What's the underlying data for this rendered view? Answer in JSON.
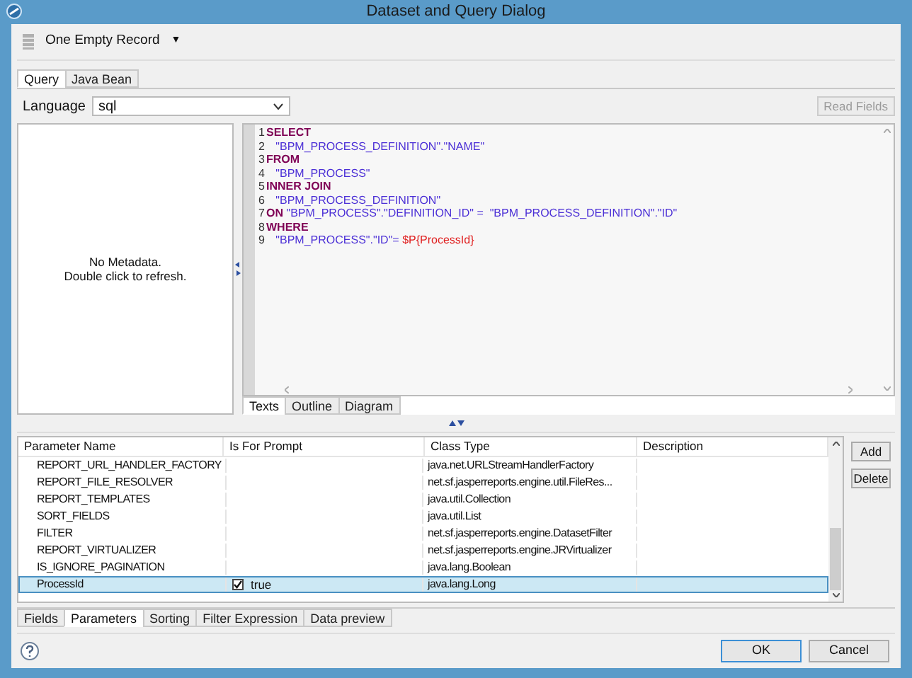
{
  "window": {
    "title": "Dataset and Query Dialog"
  },
  "toolbar": {
    "record_menu": {
      "label": "One Empty Record",
      "caret": "▼"
    }
  },
  "top_tabs": [
    {
      "label": "Query",
      "selected": true
    },
    {
      "label": "Java Bean",
      "selected": false
    }
  ],
  "language": {
    "label": "Language",
    "value": "sql",
    "read_fields": {
      "label": "Read Fields",
      "disabled": true
    }
  },
  "metadata": {
    "lines": [
      "No Metadata.",
      "Double click to refresh."
    ]
  },
  "editor": {
    "lines": [
      {
        "number": "1",
        "tokens": [
          {
            "kind": "keyword",
            "text": "SELECT"
          }
        ]
      },
      {
        "number": "2",
        "tokens": [
          {
            "kind": "string",
            "text": "   \"BPM_PROCESS_DEFINITION\".\"NAME\""
          }
        ]
      },
      {
        "number": "3",
        "tokens": [
          {
            "kind": "keyword",
            "text": "FROM"
          }
        ]
      },
      {
        "number": "4",
        "tokens": [
          {
            "kind": "string",
            "text": "   \"BPM_PROCESS\""
          }
        ]
      },
      {
        "number": "5",
        "tokens": [
          {
            "kind": "keyword",
            "text": "INNER JOIN"
          }
        ]
      },
      {
        "number": "6",
        "tokens": [
          {
            "kind": "string",
            "text": "   \"BPM_PROCESS_DEFINITION\""
          }
        ]
      },
      {
        "number": "7",
        "tokens": [
          {
            "kind": "keyword",
            "text": "ON"
          },
          {
            "kind": "string",
            "text": " \"BPM_PROCESS\".\"DEFINITION_ID\" =  \"BPM_PROCESS_DEFINITION\".\"ID\""
          }
        ]
      },
      {
        "number": "8",
        "tokens": [
          {
            "kind": "keyword",
            "text": "WHERE"
          }
        ]
      },
      {
        "number": "9",
        "tokens": [
          {
            "kind": "string",
            "text": "   \"BPM_PROCESS\".\"ID\"= "
          },
          {
            "kind": "param",
            "text": "$P{ProcessId}"
          }
        ]
      }
    ],
    "tabs": [
      {
        "label": "Texts",
        "selected": true
      },
      {
        "label": "Outline",
        "selected": false
      },
      {
        "label": "Diagram",
        "selected": false
      }
    ]
  },
  "parameters": {
    "columns": [
      "Parameter Name",
      "Is For Prompt",
      "Class Type",
      "Description"
    ],
    "rows": [
      {
        "name": "REPORT_URL_HANDLER_FACTORY",
        "class_type": "java.net.URLStreamHandlerFactory",
        "selected": false
      },
      {
        "name": "REPORT_FILE_RESOLVER",
        "class_type": "net.sf.jasperreports.engine.util.FileRes...",
        "selected": false
      },
      {
        "name": "REPORT_TEMPLATES",
        "class_type": "java.util.Collection",
        "selected": false
      },
      {
        "name": "SORT_FIELDS",
        "class_type": "java.util.List",
        "selected": false
      },
      {
        "name": "FILTER",
        "class_type": "net.sf.jasperreports.engine.DatasetFilter",
        "selected": false
      },
      {
        "name": "REPORT_VIRTUALIZER",
        "class_type": "net.sf.jasperreports.engine.JRVirtualizer",
        "selected": false
      },
      {
        "name": "IS_IGNORE_PAGINATION",
        "class_type": "java.lang.Boolean",
        "selected": false
      },
      {
        "name": "ProcessId",
        "for_prompt": {
          "checked": true,
          "label": "true"
        },
        "class_type": "java.lang.Long",
        "selected": true
      }
    ],
    "buttons": [
      "Add",
      "Delete"
    ]
  },
  "bottom_tabs": [
    {
      "label": "Fields",
      "selected": false
    },
    {
      "label": "Parameters",
      "selected": true
    },
    {
      "label": "Sorting",
      "selected": false
    },
    {
      "label": "Filter Expression",
      "selected": false
    },
    {
      "label": "Data preview",
      "selected": false
    }
  ],
  "footer": {
    "buttons": [
      {
        "label": "OK",
        "default": true
      },
      {
        "label": "Cancel",
        "default": false
      }
    ]
  }
}
